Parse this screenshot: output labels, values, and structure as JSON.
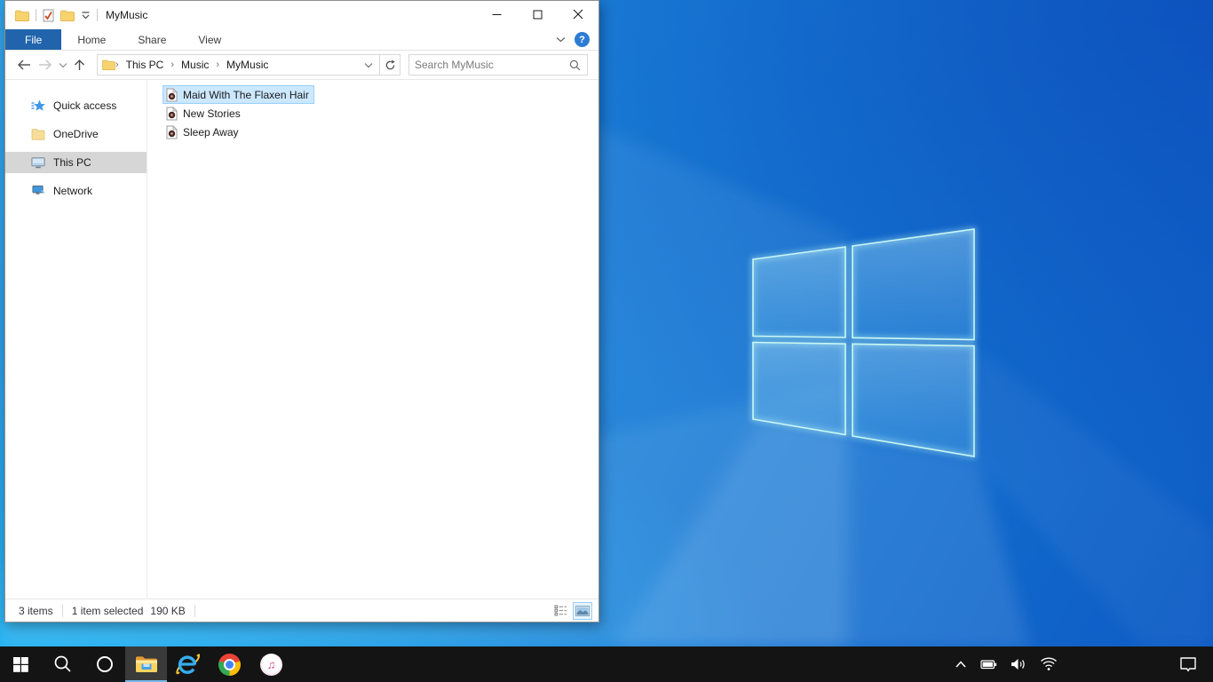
{
  "window": {
    "title": "MyMusic",
    "tabs": {
      "items": [
        {
          "label": "File",
          "active": true
        },
        {
          "label": "Home",
          "active": false
        },
        {
          "label": "Share",
          "active": false
        },
        {
          "label": "View",
          "active": false
        }
      ]
    },
    "help_label": "?",
    "breadcrumb": {
      "items": [
        "This PC",
        "Music",
        "MyMusic"
      ],
      "separator": "›"
    },
    "search": {
      "placeholder": "Search MyMusic"
    },
    "sidebar": {
      "items": [
        {
          "label": "Quick access",
          "icon": "quick-access-star-icon",
          "selected": false
        },
        {
          "label": "OneDrive",
          "icon": "onedrive-folder-icon",
          "selected": false
        },
        {
          "label": "This PC",
          "icon": "this-pc-monitor-icon",
          "selected": true
        },
        {
          "label": "Network",
          "icon": "network-icon",
          "selected": false
        }
      ]
    },
    "files": {
      "items": [
        {
          "name": "Maid With The Flaxen Hair",
          "icon": "music-file-icon",
          "selected": true
        },
        {
          "name": "New Stories",
          "icon": "music-file-icon",
          "selected": false
        },
        {
          "name": "Sleep Away",
          "icon": "music-file-icon",
          "selected": false
        }
      ]
    },
    "statusbar": {
      "count": "3 items",
      "selected": "1 item selected",
      "size": "190 KB"
    }
  },
  "taskbar": {
    "buttons": [
      "start",
      "search",
      "cortana",
      "file-explorer",
      "internet-explorer",
      "chrome",
      "itunes"
    ],
    "active_button": "file-explorer",
    "tray": [
      "hidden-icons-chevron",
      "battery",
      "volume",
      "wifi"
    ],
    "action_center": "action-center"
  },
  "colors": {
    "file_tab_blue": "#2164ac",
    "help_circle_blue": "#2d7cd4",
    "selection_bg": "#cce8ff",
    "selection_border": "#99d1ff",
    "sidebar_selected_gray": "#d6d6d6",
    "taskbar_bg": "#141414",
    "taskbar_active_underline": "#76b9ed",
    "wallpaper_top_right": "#0d5ac4",
    "wallpaper_bottom_left": "#1ab7f5",
    "logo_stroke": "#c9f8f4"
  }
}
